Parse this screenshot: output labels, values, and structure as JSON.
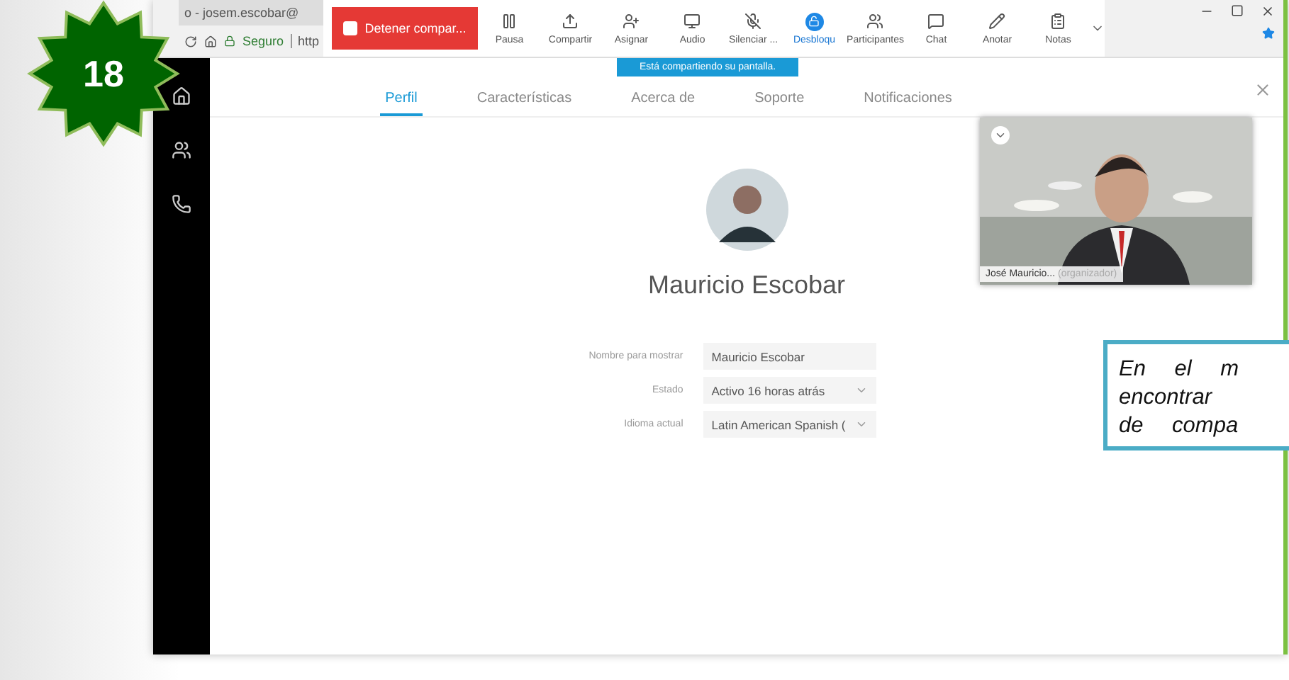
{
  "badge": {
    "number": "18"
  },
  "browser": {
    "tab_title": "o - josem.escobar@",
    "secure_label": "Seguro",
    "url": "http"
  },
  "share_toolbar": {
    "stop_button": "Detener compar...",
    "tools": [
      {
        "kind": "pause",
        "label": "Pausa",
        "active": false
      },
      {
        "kind": "share",
        "label": "Compartir",
        "active": false
      },
      {
        "kind": "assign",
        "label": "Asignar",
        "active": false
      },
      {
        "kind": "audio",
        "label": "Audio",
        "active": false
      },
      {
        "kind": "mute",
        "label": "Silenciar ...",
        "active": false
      },
      {
        "kind": "unlock",
        "label": "Desbloqu",
        "active": true
      },
      {
        "kind": "participants",
        "label": "Participantes",
        "active": false
      },
      {
        "kind": "chat",
        "label": "Chat",
        "active": false
      },
      {
        "kind": "annotate",
        "label": "Anotar",
        "active": false
      },
      {
        "kind": "notes",
        "label": "Notas",
        "active": false
      }
    ],
    "banner": "Está compartiendo su pantalla."
  },
  "tabs": [
    {
      "label": "Perfil",
      "selected": true
    },
    {
      "label": "Características",
      "selected": false
    },
    {
      "label": "Acerca de",
      "selected": false
    },
    {
      "label": "Soporte",
      "selected": false
    },
    {
      "label": "Notificaciones",
      "selected": false
    }
  ],
  "profile": {
    "name": "Mauricio Escobar",
    "fields": [
      {
        "kind": "text",
        "label": "Nombre para mostrar",
        "value": "Mauricio Escobar"
      },
      {
        "kind": "select",
        "label": "Estado",
        "value": "Activo 16 horas atrás"
      },
      {
        "kind": "select",
        "label": "Idioma actual",
        "value": "Latin American Spanish ("
      }
    ]
  },
  "video": {
    "name": "José Mauricio...",
    "role": "(organizador)"
  },
  "callout": {
    "lines": [
      "En el m",
      "encontrar",
      "de compa"
    ]
  }
}
